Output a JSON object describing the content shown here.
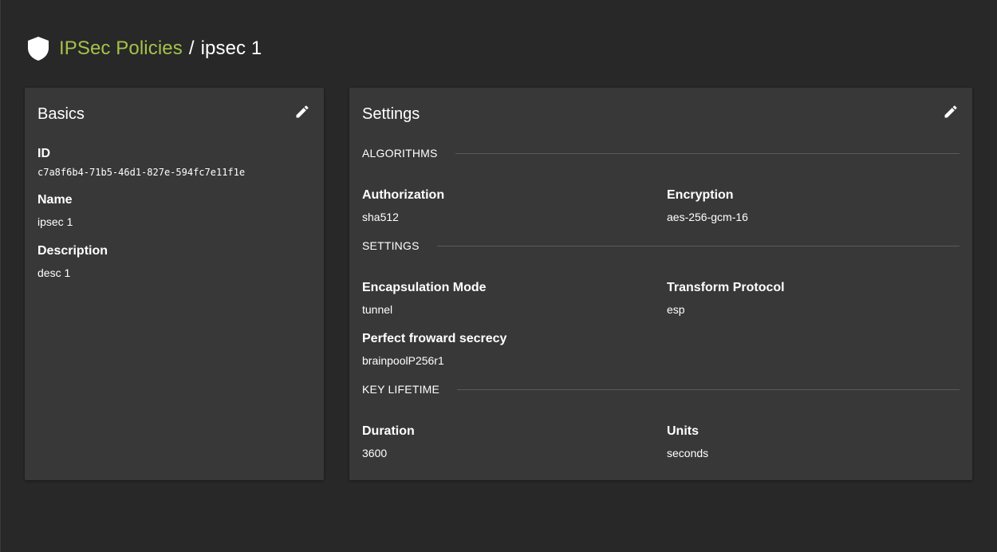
{
  "breadcrumb": {
    "parent": "IPSec Policies",
    "separator": "/",
    "current": "ipsec 1"
  },
  "colors": {
    "background": "#282828",
    "card": "#383838",
    "accent": "#a4c24a"
  },
  "icons": {
    "header": "shield-icon",
    "edit": "pencil-icon"
  },
  "basics": {
    "title": "Basics",
    "id_label": "ID",
    "id_value": "c7a8f6b4-71b5-46d1-827e-594fc7e11f1e",
    "name_label": "Name",
    "name_value": "ipsec 1",
    "description_label": "Description",
    "description_value": "desc 1"
  },
  "settings": {
    "title": "Settings",
    "algorithms": {
      "heading": "ALGORITHMS",
      "authorization_label": "Authorization",
      "authorization_value": "sha512",
      "encryption_label": "Encryption",
      "encryption_value": "aes-256-gcm-16"
    },
    "settings_section": {
      "heading": "SETTINGS",
      "encapsulation_label": "Encapsulation Mode",
      "encapsulation_value": "tunnel",
      "transform_label": "Transform Protocol",
      "transform_value": "esp",
      "pfs_label": "Perfect froward secrecy",
      "pfs_value": "brainpoolP256r1"
    },
    "key_lifetime": {
      "heading": "KEY LIFETIME",
      "duration_label": "Duration",
      "duration_value": "3600",
      "units_label": "Units",
      "units_value": "seconds"
    }
  }
}
